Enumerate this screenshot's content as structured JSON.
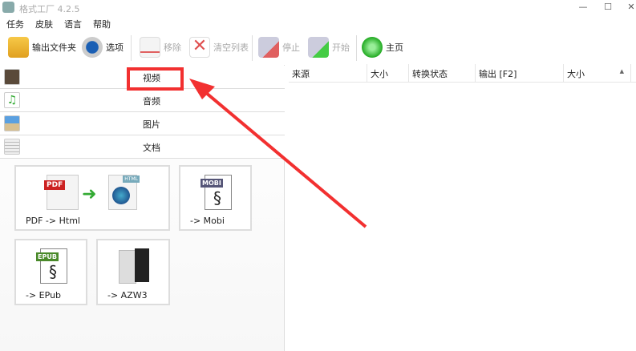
{
  "window": {
    "title": "格式工厂 4.2.5",
    "controls": [
      "—",
      "☐",
      "✕"
    ]
  },
  "menu": [
    "任务",
    "皮肤",
    "语言",
    "帮助"
  ],
  "toolbar": {
    "output_folder": "输出文件夹",
    "options": "选项",
    "remove": "移除",
    "clear_list": "清空列表",
    "stop": "停止",
    "start": "开始",
    "home": "主页"
  },
  "categories": [
    "视频",
    "音频",
    "图片",
    "文档"
  ],
  "tiles": [
    "PDF -> Html",
    "-> Mobi",
    "-> EPub",
    "-> AZW3"
  ],
  "tile_badges": {
    "pdf": "PDF",
    "html": "HTML",
    "mobi": "MOBI",
    "epub": "EPUB"
  },
  "table": {
    "columns": [
      "来源",
      "大小",
      "转换状态",
      "输出 [F2]",
      "大小"
    ],
    "sort_indicator": "▲"
  },
  "colors": {
    "annotation": "#f23030"
  }
}
